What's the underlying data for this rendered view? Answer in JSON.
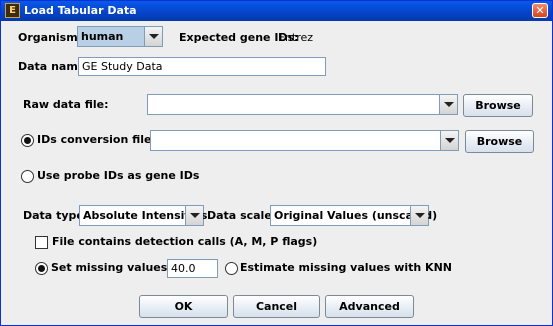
{
  "window": {
    "title": "Load Tabular Data",
    "app_icon_glyph": "E",
    "close_glyph": "✕"
  },
  "organism": {
    "label": "Organism:",
    "value": "human",
    "expected_label": "Expected gene IDs:",
    "expected_value": "Entrez"
  },
  "data_name": {
    "label": "Data name:",
    "value": "GE Study Data"
  },
  "raw_file": {
    "label": "Raw data file:",
    "value": "",
    "browse": "Browse"
  },
  "ids_conversion": {
    "label": "IDs conversion file:",
    "value": "",
    "browse": "Browse",
    "selected": true
  },
  "probe_ids": {
    "label": "Use probe IDs as gene IDs",
    "selected": false
  },
  "data_type": {
    "label": "Data type:",
    "value": "Absolute Intensities"
  },
  "data_scale": {
    "label": "Data scale:",
    "value": "Original Values (unscaled)"
  },
  "detection_calls": {
    "label": "File contains detection calls (A, M, P flags)",
    "checked": false
  },
  "missing": {
    "set_label": "Set missing values to",
    "set_value": "40.0",
    "set_selected": true,
    "knn_label": "Estimate missing values with KNN",
    "knn_selected": false
  },
  "buttons": {
    "ok": "OK",
    "cancel": "Cancel",
    "advanced": "Advanced"
  },
  "colors": {
    "titlebar": "#0a58e8",
    "window_bg": "#eeeeee",
    "border": "#7f9db9"
  }
}
